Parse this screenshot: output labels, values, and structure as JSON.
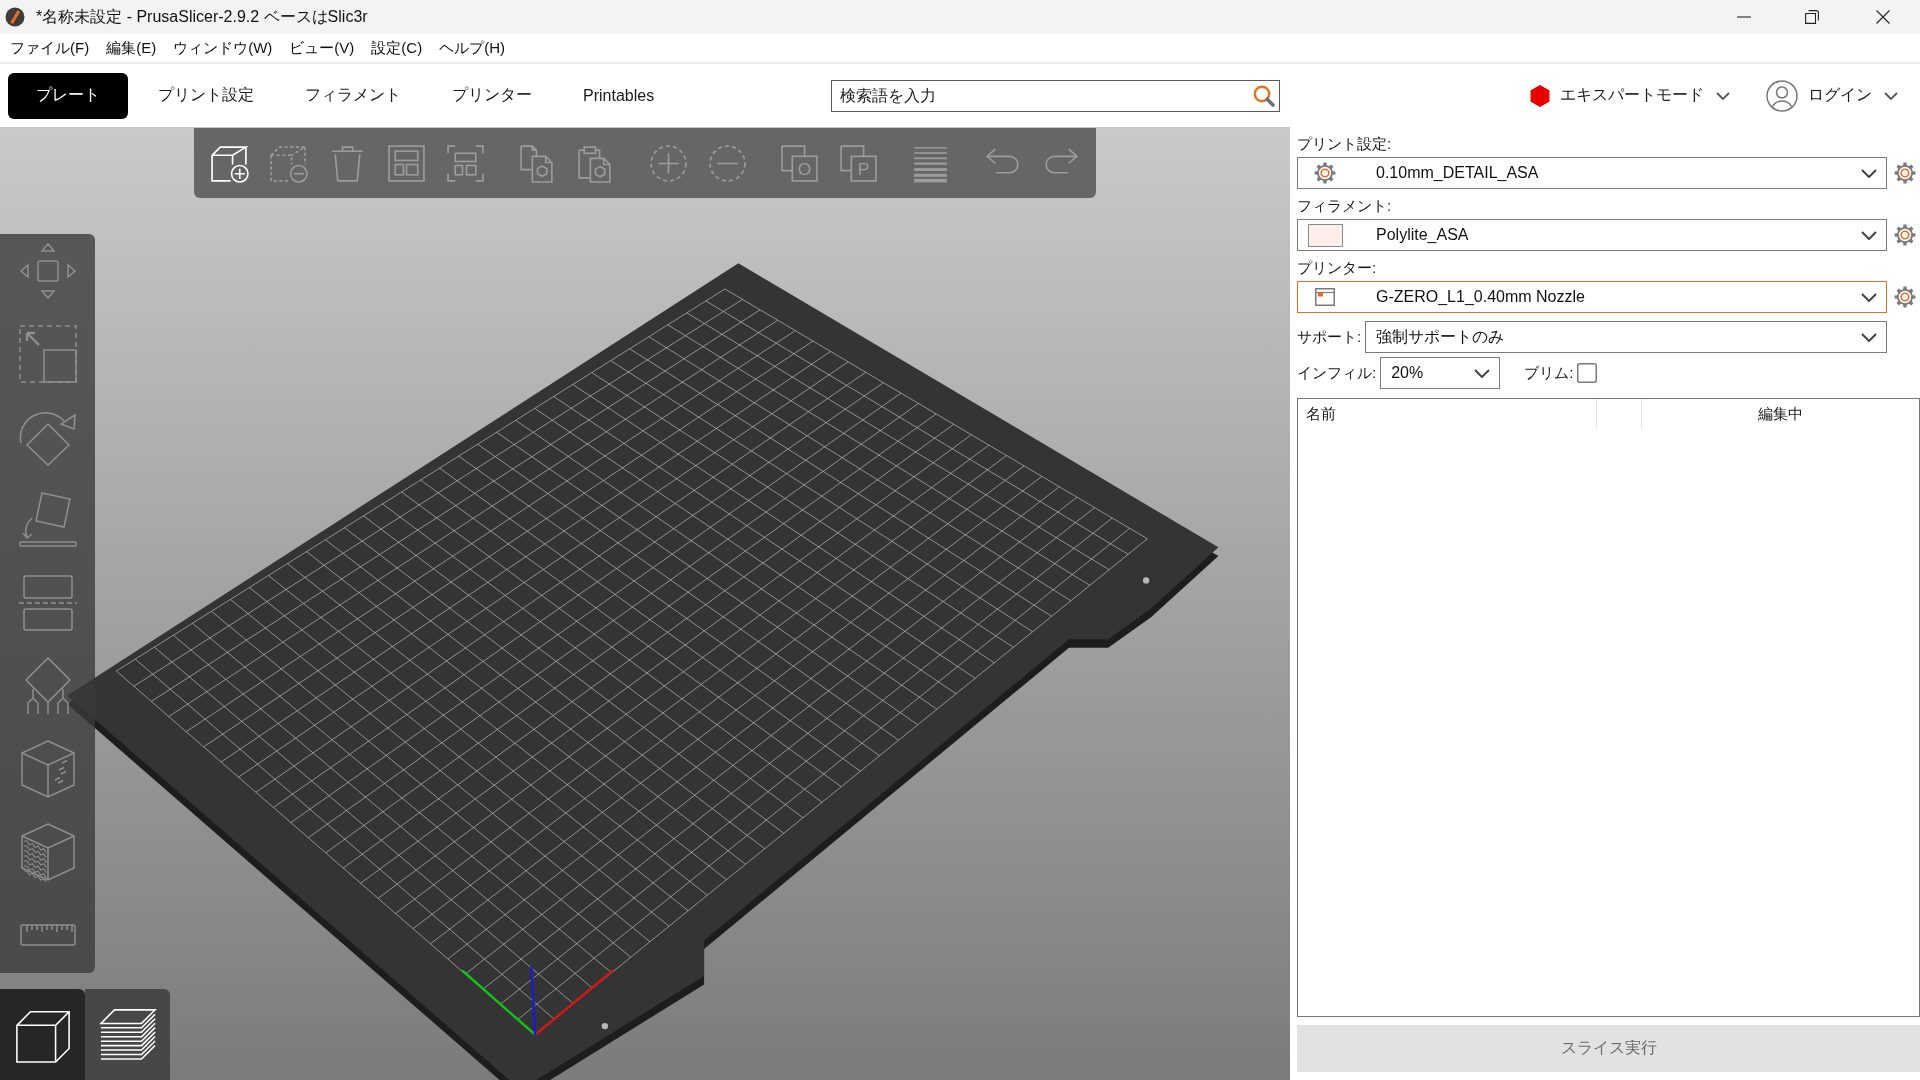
{
  "window": {
    "title": "*名称未設定 - PrusaSlicer-2.9.2 ベースはSlic3r"
  },
  "menu_bar": [
    "ファイル(F)",
    "編集(E)",
    "ウィンドウ(W)",
    "ビュー(V)",
    "設定(C)",
    "ヘルプ(H)"
  ],
  "tabs": [
    {
      "label": "プレート",
      "selected": true
    },
    {
      "label": "プリント設定",
      "selected": false
    },
    {
      "label": "フィラメント",
      "selected": false
    },
    {
      "label": "プリンター",
      "selected": false
    },
    {
      "label": "Printables",
      "selected": false
    }
  ],
  "search": {
    "placeholder": "検索語を入力"
  },
  "mode": {
    "label": "エキスパートモード"
  },
  "account": {
    "label": "ログイン"
  },
  "toolbar": [
    {
      "kind": "add",
      "disabled": false
    },
    {
      "kind": "delete",
      "disabled": true
    },
    {
      "kind": "clear",
      "disabled": true
    },
    {
      "kind": "arrange",
      "disabled": true
    },
    {
      "kind": "align",
      "disabled": true
    },
    {
      "kind": "copy",
      "disabled": true
    },
    {
      "kind": "paste",
      "disabled": true
    },
    {
      "kind": "increase",
      "disabled": true
    },
    {
      "kind": "decrease",
      "disabled": true
    },
    {
      "kind": "split",
      "disabled": true,
      "glyph": "O"
    },
    {
      "kind": "split",
      "disabled": true,
      "glyph": "P"
    },
    {
      "kind": "layers",
      "disabled": true
    },
    {
      "kind": "undo",
      "disabled": true
    },
    {
      "kind": "redo",
      "disabled": true
    }
  ],
  "gizmos": [
    {
      "kind": "move"
    },
    {
      "kind": "scale"
    },
    {
      "kind": "rotate"
    },
    {
      "kind": "flatten"
    },
    {
      "kind": "cut"
    },
    {
      "kind": "supports"
    },
    {
      "kind": "seam"
    },
    {
      "kind": "fuzzy"
    },
    {
      "kind": "measure"
    }
  ],
  "view_buttons": [
    {
      "kind": "model",
      "selected": true
    },
    {
      "kind": "preview",
      "selected": false
    }
  ],
  "presets": [
    {
      "kind": "print",
      "label": "プリント設定:",
      "value": "0.10mm_DETAIL_ASA",
      "focused": false
    },
    {
      "kind": "filament",
      "label": "フィラメント:",
      "value": "Polylite_ASA",
      "color": "#fdeee9",
      "focused": false
    },
    {
      "kind": "printer",
      "label": "プリンター:",
      "value": "G-ZERO_L1_0.40mm Nozzle",
      "focused": true
    }
  ],
  "support": {
    "label": "サポート:",
    "value": "強制サポートのみ"
  },
  "infill": {
    "label": "インフィル:",
    "value": "20%"
  },
  "brim": {
    "label": "ブリム:",
    "checked": false
  },
  "object_list": {
    "columns": [
      "名前",
      "編集中"
    ]
  },
  "slice_button": {
    "label": "スライス実行",
    "disabled": true
  }
}
